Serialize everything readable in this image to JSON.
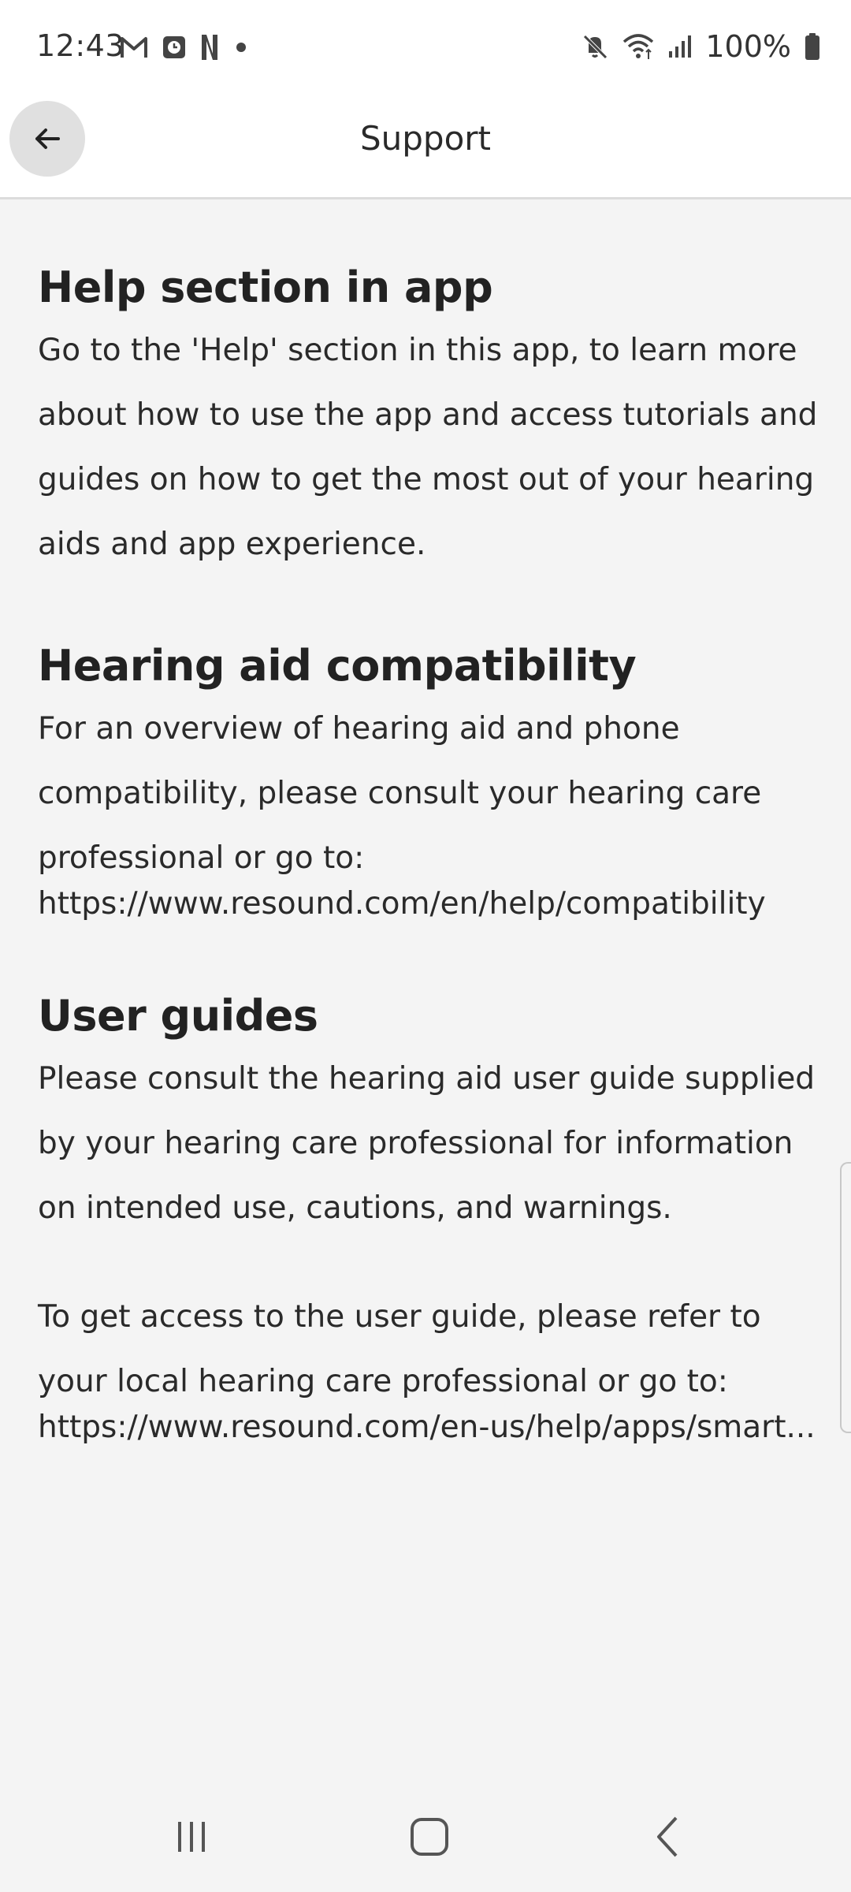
{
  "status_bar": {
    "time": "12:43",
    "battery": "100%",
    "left_icons": [
      "gmail-icon",
      "clock-app-icon",
      "netflix-icon",
      "dot-icon"
    ],
    "right_icons": [
      "mute-icon",
      "wifi-icon",
      "signal-icon",
      "battery-icon"
    ]
  },
  "app_bar": {
    "title": "Support",
    "back_icon": "arrow-left-icon"
  },
  "sections": {
    "help": {
      "heading": "Help section in app",
      "body": "Go to the 'Help' section in this app, to learn more about how to use the app and access tutorials and guides on how to get the most out of your hearing aids and app experience."
    },
    "compatibility": {
      "heading": "Hearing aid compatibility",
      "body": "For an overview of hearing aid and phone compatibility, please consult your hearing care professional or go to:",
      "link": "https://www.resound.com/en/help/compatibility"
    },
    "user_guides": {
      "heading": "User guides",
      "body": "Please consult the hearing aid user guide supplied by your hearing care professional for information on intended use, cautions, and warnings.",
      "body2": "To get access to the user guide, please refer to your local hearing care professional or go to:",
      "link": "https://www.resound.com/en-us/help/apps/smart..."
    }
  },
  "nav_bar": {
    "icons": [
      "recent-apps-icon",
      "home-icon",
      "back-icon"
    ]
  }
}
